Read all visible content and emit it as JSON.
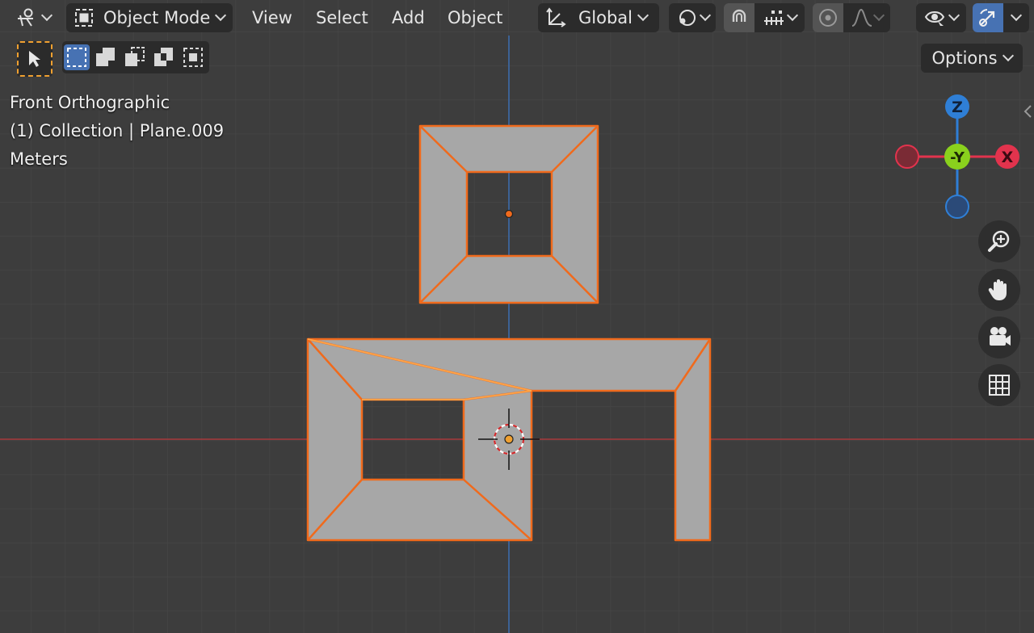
{
  "header": {
    "mode_label": "Object Mode",
    "menus": [
      "View",
      "Select",
      "Add",
      "Object"
    ],
    "transform_orientation": "Global",
    "options_label": "Options"
  },
  "overlay": {
    "view_name": "Front Orthographic",
    "collection_info": "(1) Collection | Plane.009",
    "units": "Meters"
  },
  "gizmo": {
    "z_label": "Z",
    "y_label": "-Y",
    "x_label": "X",
    "colors": {
      "x": "#e2334d",
      "y": "#8ad11d",
      "z": "#2f7fd6"
    }
  },
  "nav_icons": [
    "zoom-icon",
    "hand-pan-icon",
    "camera-icon",
    "grid-icon"
  ],
  "colors": {
    "background": "#3d3d3d",
    "mesh_fill": "#a7a7a7",
    "selection_outline": "#f06a1c",
    "active_blue": "#4772b3",
    "x_axis": "#b03a3a",
    "z_axis": "#3a6fb0"
  }
}
